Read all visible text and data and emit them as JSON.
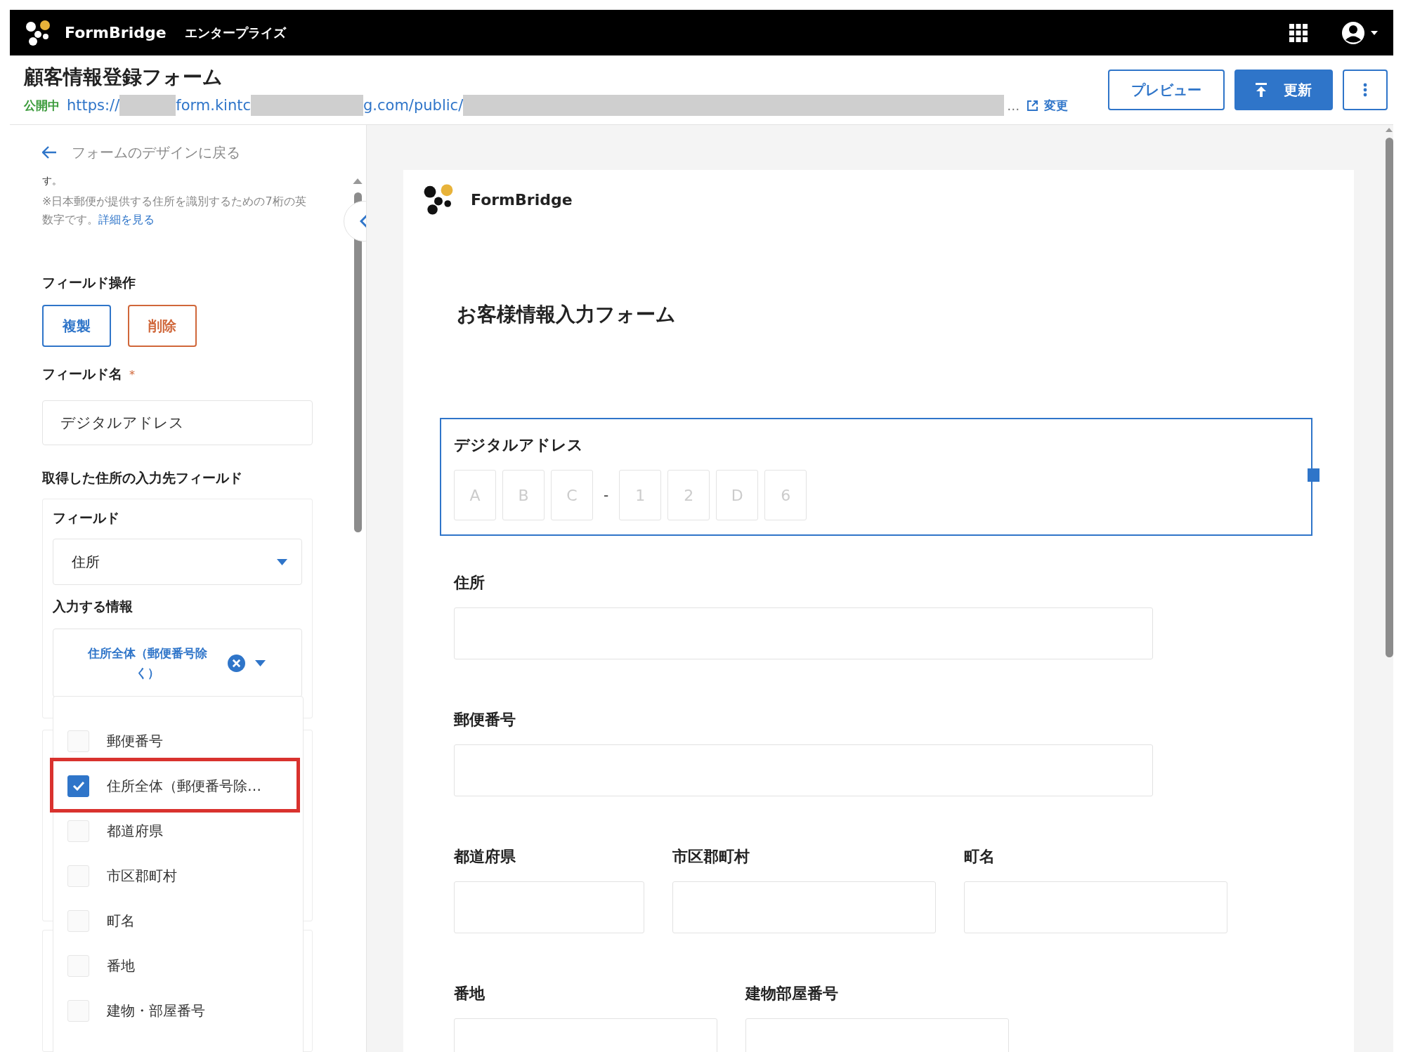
{
  "app_bar": {
    "brand": "FormBridge",
    "edition": "エンタープライズ"
  },
  "header": {
    "title": "顧客情報登録フォーム",
    "status": "公開中",
    "url_parts": [
      "https://",
      "form.kintc",
      "g.com/public/"
    ],
    "url_ellipsis": "…",
    "change_link": "変更",
    "buttons": [
      {
        "kind": "outline",
        "label": "プレビュー"
      },
      {
        "kind": "primary",
        "label": "更新"
      },
      {
        "kind": "more"
      }
    ]
  },
  "settings": {
    "back_link": "フォームのデザインに戻る",
    "cut_text": "す。",
    "note": "※日本郵便が提供する住所を識別するための7桁の英数字です。",
    "note_link": "詳細を見る",
    "field_ops_label": "フィールド操作",
    "ops": [
      {
        "kind": "copy",
        "label": "複製"
      },
      {
        "kind": "delete",
        "label": "削除"
      }
    ],
    "field_name_label": "フィールド名",
    "required_mark": "*",
    "field_name_value": "デジタルアドレス",
    "target_label": "取得した住所の入力先フィールド",
    "field_label": "フィールド",
    "field_value": "住所",
    "info_label": "入力する情報",
    "info_value": "住所全体（郵便番号除く）",
    "options": [
      {
        "label": "郵便番号",
        "checked": false,
        "highlighted": false
      },
      {
        "label": "住所全体（郵便番号除…",
        "checked": true,
        "highlighted": true
      },
      {
        "label": "都道府県",
        "checked": false,
        "highlighted": false
      },
      {
        "label": "市区郡町村",
        "checked": false,
        "highlighted": false
      },
      {
        "label": "町名",
        "checked": false,
        "highlighted": false
      },
      {
        "label": "番地",
        "checked": false,
        "highlighted": false
      },
      {
        "label": "建物・部屋番号",
        "checked": false,
        "highlighted": false
      }
    ]
  },
  "form": {
    "brand": "FormBridge",
    "title": "お客様情報入力フォーム",
    "digital_address": {
      "label": "デジタルアドレス",
      "selected": true,
      "groups": [
        [
          "A",
          "B",
          "C"
        ],
        [
          "1",
          "2",
          "D",
          "6"
        ]
      ],
      "separator": "-"
    },
    "rows": [
      [
        {
          "label": "住所",
          "selected": false
        }
      ],
      [
        {
          "label": "郵便番号",
          "selected": false
        }
      ],
      [
        {
          "label": "都道府県",
          "selected": false
        },
        {
          "label": "市区郡町村",
          "selected": false
        },
        {
          "label": "町名",
          "selected": false
        }
      ],
      [
        {
          "label": "番地",
          "selected": false
        },
        {
          "label": "建物部屋番号",
          "selected": false
        }
      ]
    ]
  }
}
